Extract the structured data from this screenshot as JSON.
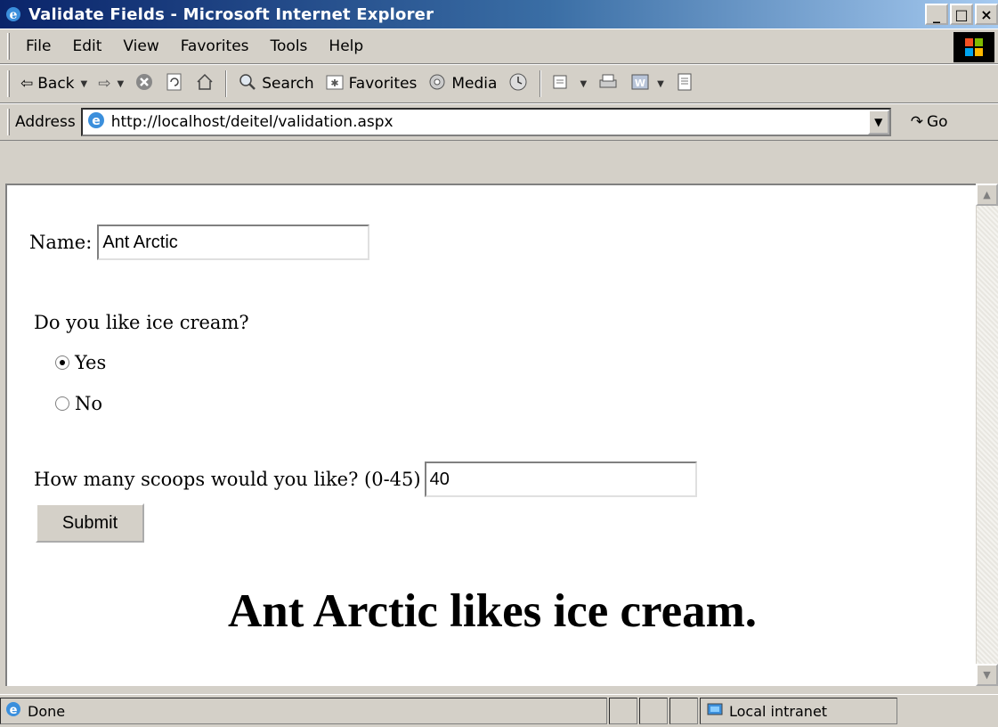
{
  "window": {
    "title": "Validate Fields - Microsoft Internet Explorer",
    "controls": [
      "_",
      "□",
      "×"
    ]
  },
  "menu": [
    "File",
    "Edit",
    "View",
    "Favorites",
    "Tools",
    "Help"
  ],
  "toolbar": {
    "back": "Back",
    "search": "Search",
    "favorites": "Favorites",
    "media": "Media"
  },
  "address": {
    "label": "Address",
    "url": "http://localhost/deitel/validation.aspx",
    "go": "Go"
  },
  "form": {
    "name_label": "Name:",
    "name_value": "Ant Arctic",
    "question": "Do you like ice cream?",
    "options": [
      {
        "label": "Yes",
        "selected": true
      },
      {
        "label": "No",
        "selected": false
      }
    ],
    "scoops_label": "How many scoops would you like? (0-45)",
    "scoops_value": "40",
    "submit_label": "Submit"
  },
  "result": "Ant Arctic likes ice cream.",
  "status": {
    "text": "Done",
    "zone": "Local intranet"
  }
}
